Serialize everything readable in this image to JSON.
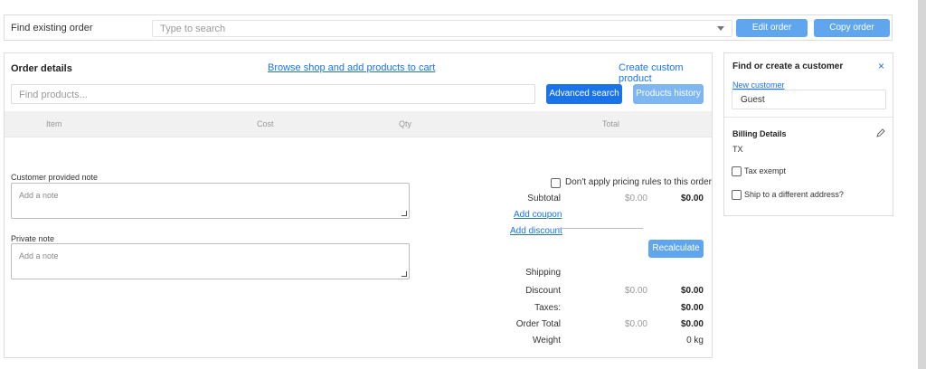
{
  "finder": {
    "label": "Find existing order",
    "placeholder": "Type to search",
    "edit_label": "Edit order",
    "copy_label": "Copy order"
  },
  "order": {
    "title": "Order details",
    "browse_link": "Browse shop and add products to cart",
    "custom_link": "Create custom product",
    "find_placeholder": "Find products...",
    "advanced_search": "Advanced search",
    "products_history": "Products history",
    "columns": [
      "Item",
      "Cost",
      "Qty",
      "Total"
    ]
  },
  "notes": {
    "customer_label": "Customer provided note",
    "customer_placeholder": "Add a note",
    "private_label": "Private note",
    "private_placeholder": "Add a note"
  },
  "summary": {
    "no_pricing_rules": "Don't apply pricing rules to this order",
    "subtotal_label": "Subtotal",
    "subtotal_old": "$0.00",
    "subtotal_new": "$0.00",
    "add_coupon": "Add coupon",
    "add_discount": "Add discount",
    "recalculate": "Recalculate",
    "shipping_label": "Shipping",
    "discount_label": "Discount",
    "discount_old": "$0.00",
    "discount_new": "$0.00",
    "taxes_label": "Taxes:",
    "taxes_value": "$0.00",
    "order_total_label": "Order Total",
    "order_total_old": "$0.00",
    "order_total_new": "$0.00",
    "weight_label": "Weight",
    "weight_value": "0 kg"
  },
  "customer": {
    "title": "Find or create a customer",
    "close": "×",
    "new_customer": "New customer",
    "guest": "Guest",
    "billing_title": "Billing Details",
    "billing_state": "TX",
    "tax_exempt": "Tax exempt",
    "ship_different": "Ship to a different address?"
  },
  "colors": {
    "accent": "#1a73e8",
    "button_primary": "#1a73e8",
    "button_light": "#5fa6ee"
  }
}
